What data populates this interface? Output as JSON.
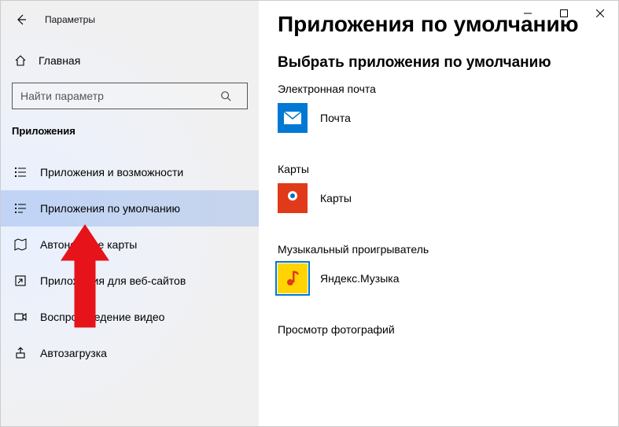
{
  "window": {
    "title": "Параметры"
  },
  "home": {
    "label": "Главная"
  },
  "search": {
    "placeholder": "Найти параметр"
  },
  "section": {
    "header": "Приложения"
  },
  "nav": {
    "items": [
      {
        "label": "Приложения и возможности"
      },
      {
        "label": "Приложения по умолчанию"
      },
      {
        "label": "Автономные карты"
      },
      {
        "label": "Приложения для веб-сайтов"
      },
      {
        "label": "Воспроизведение видео"
      },
      {
        "label": "Автозагрузка"
      }
    ]
  },
  "main": {
    "title": "Приложения по умолчанию",
    "subtitle": "Выбрать приложения по умолчанию",
    "groups": [
      {
        "category": "Электронная почта",
        "app": "Почта"
      },
      {
        "category": "Карты",
        "app": "Карты"
      },
      {
        "category": "Музыкальный проигрыватель",
        "app": "Яндекс.Музыка"
      },
      {
        "category": "Просмотр фотографий",
        "app": ""
      }
    ]
  }
}
